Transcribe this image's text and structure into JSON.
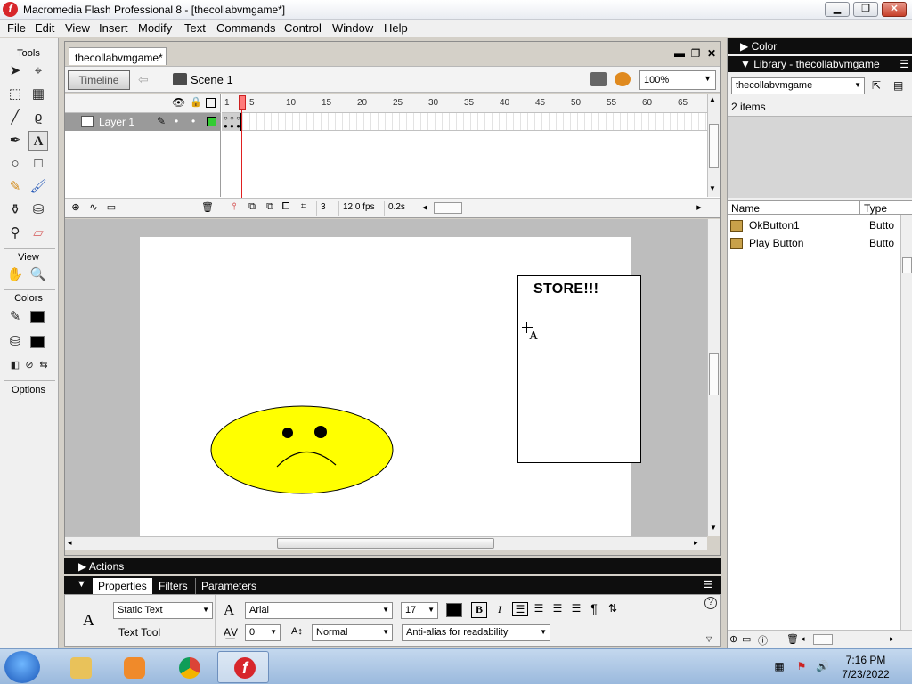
{
  "window": {
    "title": "Macromedia Flash Professional 8 - [thecollabvmgame*]",
    "app_icon_glyph": "f"
  },
  "menu": [
    "File",
    "Edit",
    "View",
    "Insert",
    "Modify",
    "Text",
    "Commands",
    "Control",
    "Window",
    "Help"
  ],
  "tools_panel": {
    "header_tools": "Tools",
    "header_view": "View",
    "header_colors": "Colors",
    "header_options": "Options"
  },
  "document": {
    "tab_label": "thecollabvmgame*",
    "timeline_button": "Timeline",
    "scene_label": "Scene 1",
    "zoom": "100%"
  },
  "timeline": {
    "layer_name": "Layer 1",
    "ruler_ticks": [
      "1",
      "5",
      "10",
      "15",
      "20",
      "25",
      "30",
      "35",
      "40",
      "45",
      "50",
      "55",
      "60",
      "65"
    ],
    "current_frame": "3",
    "frame_rate": "12.0 fps",
    "elapsed_time": "0.2s"
  },
  "stage": {
    "store_text": "STORE!!!",
    "text_cursor_glyph": "A",
    "face_fill_color": "#ffff00"
  },
  "panels": {
    "actions_label": "Actions",
    "properties_tab": "Properties",
    "filters_tab": "Filters",
    "parameters_tab": "Parameters",
    "text_type": "Static Text",
    "tool_name": "Text Tool",
    "font": "Arial",
    "font_size": "17",
    "letter_spacing": "0",
    "character_position": "Normal",
    "anti_alias": "Anti-alias for readability",
    "bold_label": "B",
    "italic_label": "I",
    "text_tool_glyph": "A"
  },
  "right_panel": {
    "color_header": "Color",
    "library_header": "Library - thecollabvmgame",
    "library_select": "thecollabvmgame",
    "items_count": "2 items",
    "col_name": "Name",
    "col_type": "Type",
    "items": [
      {
        "name": "OkButton1",
        "type": "Butto"
      },
      {
        "name": "Play Button",
        "type": "Butto"
      }
    ]
  },
  "taskbar": {
    "time": "7:16 PM",
    "date": "7/23/2022",
    "flash_glyph": "f"
  },
  "colors": {
    "accent": "#d7262b",
    "panel_header": "#0e0e0e"
  }
}
